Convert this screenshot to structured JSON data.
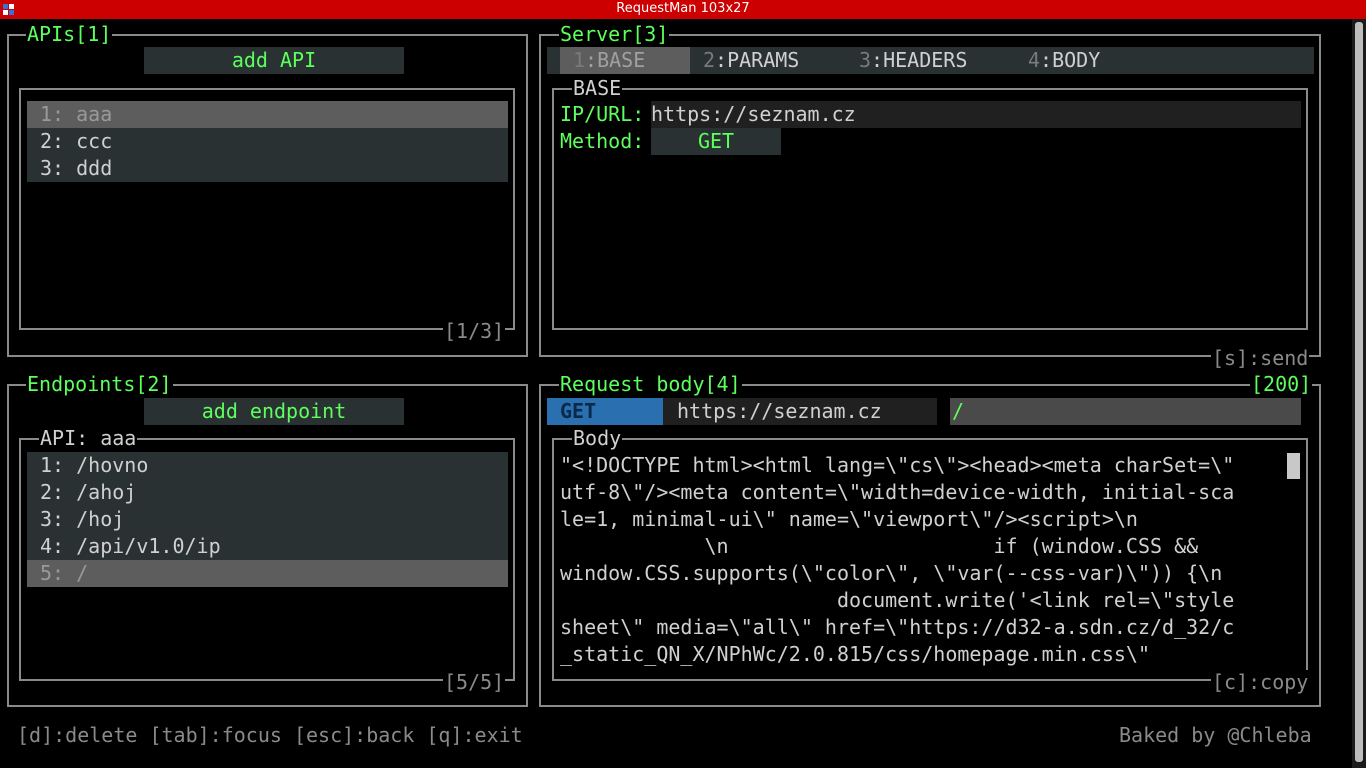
{
  "window": {
    "title": "RequestMan 103x27"
  },
  "apis_panel": {
    "title": "APIs[1]",
    "add_label": "add API",
    "items": [
      "1: aaa",
      "2: ccc",
      "3: ddd"
    ],
    "counter": "[1/3]"
  },
  "server_panel": {
    "title": "Server[3]",
    "tabs": [
      {
        "num": "1",
        "label": ":BASE"
      },
      {
        "num": "2",
        "label": ":PARAMS"
      },
      {
        "num": "3",
        "label": ":HEADERS"
      },
      {
        "num": "4",
        "label": ":BODY"
      }
    ],
    "section_title": "BASE",
    "url_label": "IP/URL:",
    "url_value": "https://seznam.cz",
    "method_label": "Method:",
    "method_value": "GET",
    "send_hint": "[s]:send"
  },
  "endpoints_panel": {
    "title": "Endpoints[2]",
    "add_label": "add endpoint",
    "section_title": "API: aaa",
    "items": [
      "1: /hovno",
      "2: /ahoj",
      "3: /hoj",
      "4: /api/v1.0/ip",
      "5: /"
    ],
    "counter": "[5/5]"
  },
  "request_body_panel": {
    "title": "Request body[4]",
    "status": "[200]",
    "method": "GET",
    "url": "https://seznam.cz",
    "path": "/",
    "section_title": "Body",
    "lines": [
      "\"<!DOCTYPE html><html lang=\\\"cs\\\"><head><meta charSet=\\\"",
      "utf-8\\\"/><meta content=\\\"width=device-width, initial-sca",
      "le=1, minimal-ui\\\" name=\\\"viewport\\\"/><script>\\n",
      "            \\n                      if (window.CSS &&",
      "window.CSS.supports(\\\"color\\\", \\\"var(--css-var)\\\")) {\\n",
      "                       document.write('<link rel=\\\"style",
      "sheet\\\" media=\\\"all\\\" href=\\\"https://d32-a.sdn.cz/d_32/c",
      "_static_QN_X/NPhWc/2.0.815/css/homepage.min.css\\\""
    ],
    "copy_hint": "[c]:copy"
  },
  "footer": {
    "keys": "[d]:delete [tab]:focus [esc]:back [q]:exit",
    "credit": "Baked by @Chleba"
  }
}
